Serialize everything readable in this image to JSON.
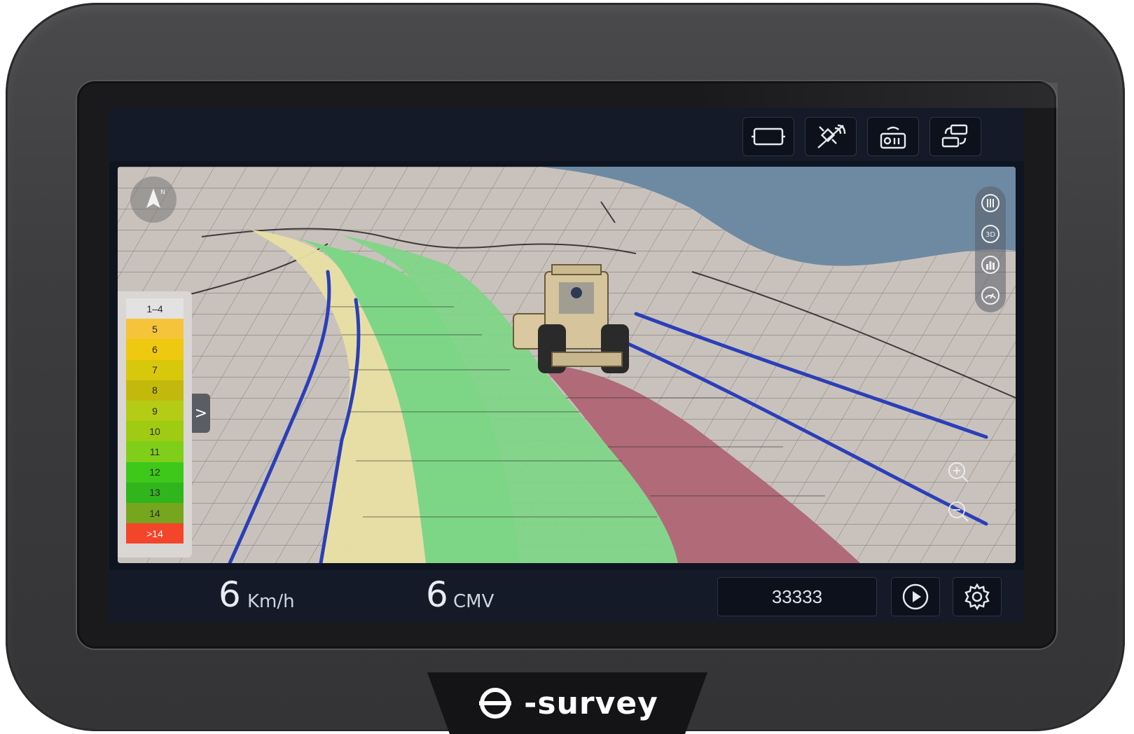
{
  "brand": {
    "logo_text": "-survey"
  },
  "topbar": {
    "buttons": [
      {
        "name": "view-frame-button",
        "icon": "frame-icon"
      },
      {
        "name": "satellite-button",
        "icon": "satellite-icon"
      },
      {
        "name": "radio-button",
        "icon": "radio-icon"
      },
      {
        "name": "switch-view-button",
        "icon": "switch-icon"
      }
    ]
  },
  "map": {
    "compass_label": "N",
    "legend": {
      "rows": [
        {
          "label": "1–4",
          "color": "#e2e2e2"
        },
        {
          "label": "5",
          "color": "#f6c43a"
        },
        {
          "label": "6",
          "color": "#eec90f"
        },
        {
          "label": "7",
          "color": "#d7c80b"
        },
        {
          "label": "8",
          "color": "#c3b90d"
        },
        {
          "label": "9",
          "color": "#b4cc16"
        },
        {
          "label": "10",
          "color": "#9fcb12"
        },
        {
          "label": "11",
          "color": "#7fcf1a"
        },
        {
          "label": "12",
          "color": "#3ec81a"
        },
        {
          "label": "13",
          "color": "#30b51c"
        },
        {
          "label": "14",
          "color": "#76a61e"
        },
        {
          "label": ">14",
          "color": "#f3452a"
        }
      ],
      "toggle_glyph": ">"
    },
    "side_tools": [
      {
        "name": "layers-tool",
        "label": ""
      },
      {
        "name": "3d-tool",
        "label": "3D"
      },
      {
        "name": "stats-tool",
        "label": ""
      },
      {
        "name": "gauge-tool",
        "label": ""
      }
    ]
  },
  "bottombar": {
    "speed": {
      "value": "6",
      "unit": "Km/h"
    },
    "cmv": {
      "value": "6",
      "unit": "CMV"
    },
    "field_value": "33333"
  },
  "colors": {
    "pass_yellow": "#e9dfa4",
    "pass_green": "#7dd686",
    "pass_red": "#b06a78",
    "sky": "#6e8aa3",
    "terrain": "#c9c2bc",
    "boundary_blue": "#2b3fb8"
  }
}
